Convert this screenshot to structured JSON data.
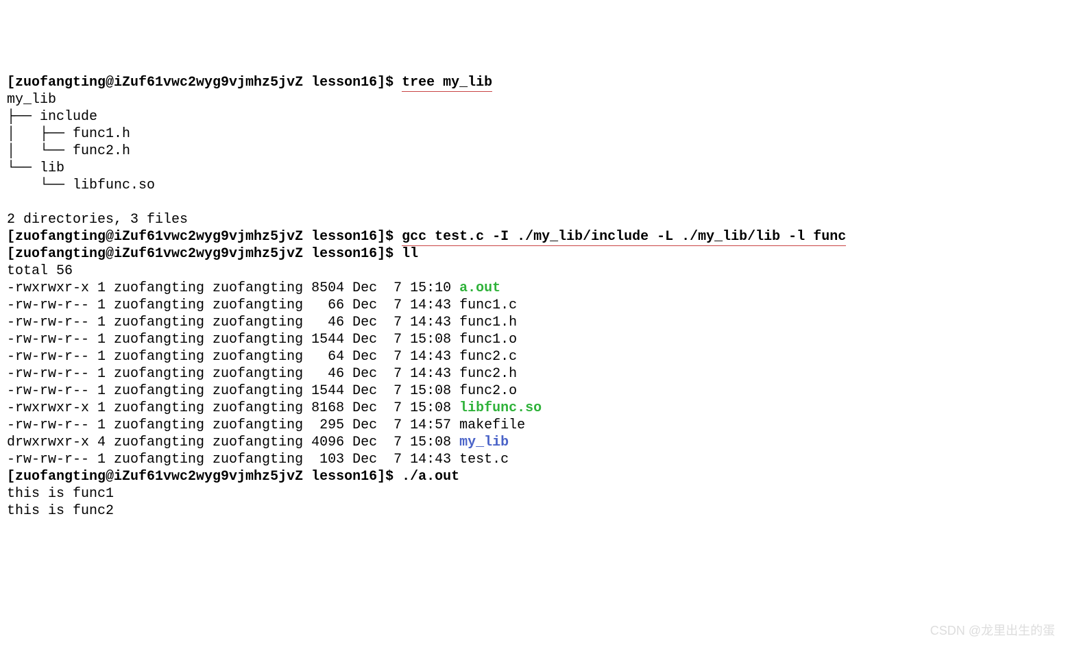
{
  "prompt": "[zuofangting@iZuf61vwc2wyg9vjmhz5jvZ lesson16]$ ",
  "cmd1": "tree my_lib",
  "tree": {
    "l1": "my_lib",
    "l2": "├── include",
    "l3": "│   ├── func1.h",
    "l4": "│   └── func2.h",
    "l5": "└── lib",
    "l6": "    └── libfunc.so"
  },
  "summary": "2 directories, 3 files",
  "cmd2": "gcc test.c -I ./my_lib/include -L ./my_lib/lib -l func",
  "cmd3": "ll",
  "total": "total 56",
  "ls": [
    {
      "pre": "-rwxrwxr-x 1 zuofangting zuofangting 8504 Dec  7 15:10 ",
      "name": "a.out",
      "cls": "green"
    },
    {
      "pre": "-rw-rw-r-- 1 zuofangting zuofangting   66 Dec  7 14:43 ",
      "name": "func1.c",
      "cls": ""
    },
    {
      "pre": "-rw-rw-r-- 1 zuofangting zuofangting   46 Dec  7 14:43 ",
      "name": "func1.h",
      "cls": ""
    },
    {
      "pre": "-rw-rw-r-- 1 zuofangting zuofangting 1544 Dec  7 15:08 ",
      "name": "func1.o",
      "cls": ""
    },
    {
      "pre": "-rw-rw-r-- 1 zuofangting zuofangting   64 Dec  7 14:43 ",
      "name": "func2.c",
      "cls": ""
    },
    {
      "pre": "-rw-rw-r-- 1 zuofangting zuofangting   46 Dec  7 14:43 ",
      "name": "func2.h",
      "cls": ""
    },
    {
      "pre": "-rw-rw-r-- 1 zuofangting zuofangting 1544 Dec  7 15:08 ",
      "name": "func2.o",
      "cls": ""
    },
    {
      "pre": "-rwxrwxr-x 1 zuofangting zuofangting 8168 Dec  7 15:08 ",
      "name": "libfunc.so",
      "cls": "green"
    },
    {
      "pre": "-rw-rw-r-- 1 zuofangting zuofangting  295 Dec  7 14:57 ",
      "name": "makefile",
      "cls": ""
    },
    {
      "pre": "drwxrwxr-x 4 zuofangting zuofangting 4096 Dec  7 15:08 ",
      "name": "my_lib",
      "cls": "blue"
    },
    {
      "pre": "-rw-rw-r-- 1 zuofangting zuofangting  103 Dec  7 14:43 ",
      "name": "test.c",
      "cls": ""
    }
  ],
  "cmd4": "./a.out",
  "out1": "this is func1",
  "out2": "this is func2",
  "watermark": "CSDN @龙里出生的蛋"
}
